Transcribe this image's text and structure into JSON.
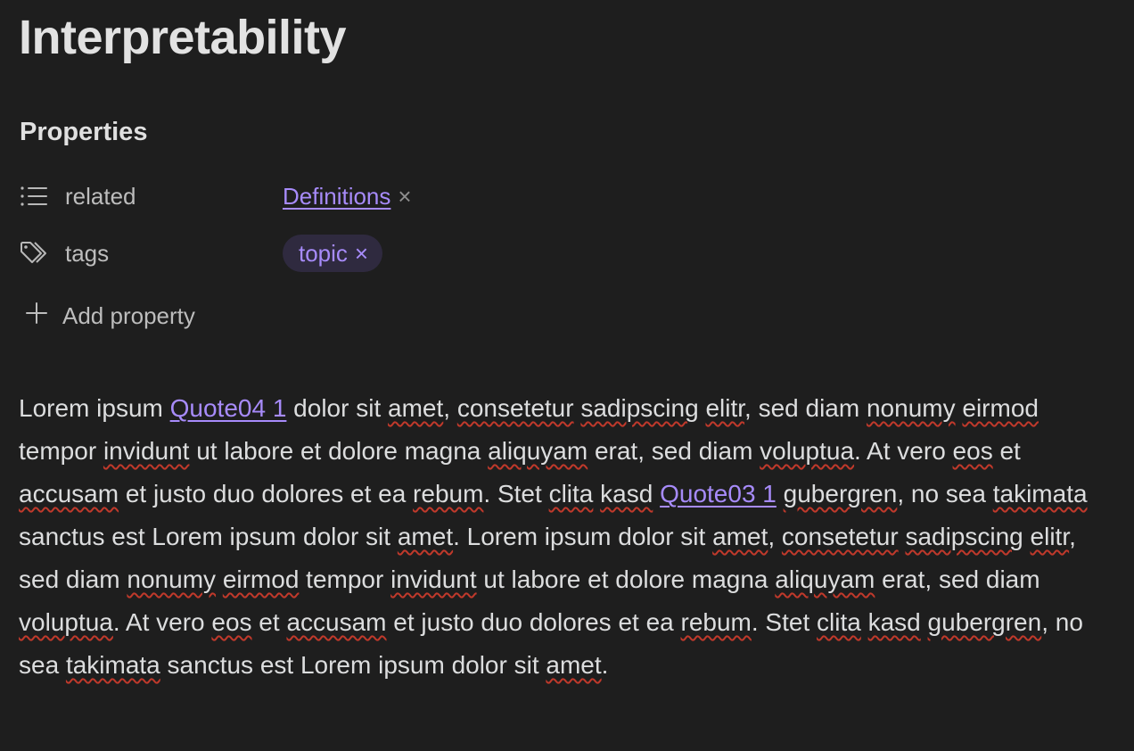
{
  "note": {
    "title": "Interpretability"
  },
  "properties": {
    "heading": "Properties",
    "rows": [
      {
        "icon": "list-icon",
        "key": "related",
        "value": "Definitions",
        "remove": "×"
      },
      {
        "icon": "tags-icon",
        "key": "tags",
        "value": "topic",
        "remove": "×"
      }
    ],
    "add_label": "Add property"
  },
  "body": {
    "segments": [
      {
        "text": "Lorem ipsum "
      },
      {
        "text": "Quote04 1",
        "link": true
      },
      {
        "text": " dolor sit "
      },
      {
        "text": "amet",
        "spell": true
      },
      {
        "text": ", "
      },
      {
        "text": "consetetur",
        "spell": true
      },
      {
        "text": " "
      },
      {
        "text": "sadipscing",
        "spell": true
      },
      {
        "text": " "
      },
      {
        "text": "elitr",
        "spell": true
      },
      {
        "text": ", sed diam "
      },
      {
        "text": "nonumy",
        "spell": true
      },
      {
        "text": " "
      },
      {
        "text": "eirmod",
        "spell": true
      },
      {
        "text": " tempor "
      },
      {
        "text": "invidunt",
        "spell": true
      },
      {
        "text": " ut labore et dolore magna "
      },
      {
        "text": "aliquyam",
        "spell": true
      },
      {
        "text": " erat, sed diam "
      },
      {
        "text": "voluptua",
        "spell": true
      },
      {
        "text": ". At vero "
      },
      {
        "text": "eos",
        "spell": true
      },
      {
        "text": " et "
      },
      {
        "text": "accusam",
        "spell": true
      },
      {
        "text": " et justo duo dolores et ea "
      },
      {
        "text": "rebum",
        "spell": true
      },
      {
        "text": ". Stet "
      },
      {
        "text": "clita",
        "spell": true
      },
      {
        "text": " "
      },
      {
        "text": "kasd",
        "spell": true
      },
      {
        "text": " "
      },
      {
        "text": "Quote03 1",
        "link": true
      },
      {
        "text": " "
      },
      {
        "text": "gubergren",
        "spell": true
      },
      {
        "text": ", no sea "
      },
      {
        "text": "takimata",
        "spell": true
      },
      {
        "text": " sanctus est Lorem ipsum dolor sit "
      },
      {
        "text": "amet",
        "spell": true
      },
      {
        "text": ". Lorem ipsum dolor sit "
      },
      {
        "text": "amet",
        "spell": true
      },
      {
        "text": ", "
      },
      {
        "text": "consetetur",
        "spell": true
      },
      {
        "text": " "
      },
      {
        "text": "sadipscing",
        "spell": true
      },
      {
        "text": " "
      },
      {
        "text": "elitr",
        "spell": true
      },
      {
        "text": ", sed diam "
      },
      {
        "text": "nonumy",
        "spell": true
      },
      {
        "text": " "
      },
      {
        "text": "eirmod",
        "spell": true
      },
      {
        "text": " tempor "
      },
      {
        "text": "invidunt",
        "spell": true
      },
      {
        "text": " ut labore et dolore magna "
      },
      {
        "text": "aliquyam",
        "spell": true
      },
      {
        "text": " erat, sed diam "
      },
      {
        "text": "voluptua",
        "spell": true
      },
      {
        "text": ". At vero "
      },
      {
        "text": "eos",
        "spell": true
      },
      {
        "text": " et "
      },
      {
        "text": "accusam",
        "spell": true
      },
      {
        "text": " et justo duo dolores et ea "
      },
      {
        "text": "rebum",
        "spell": true
      },
      {
        "text": ". Stet "
      },
      {
        "text": "clita",
        "spell": true
      },
      {
        "text": " "
      },
      {
        "text": "kasd",
        "spell": true
      },
      {
        "text": " "
      },
      {
        "text": "gubergren",
        "spell": true
      },
      {
        "text": ", no sea "
      },
      {
        "text": "takimata",
        "spell": true
      },
      {
        "text": " sanctus est Lorem ipsum dolor sit "
      },
      {
        "text": "amet",
        "spell": true
      },
      {
        "text": "."
      }
    ]
  },
  "colors": {
    "background": "#1e1e1e",
    "accent": "#a78bfa",
    "tag_background": "#2f2a3f",
    "spellcheck": "#c0392b"
  }
}
